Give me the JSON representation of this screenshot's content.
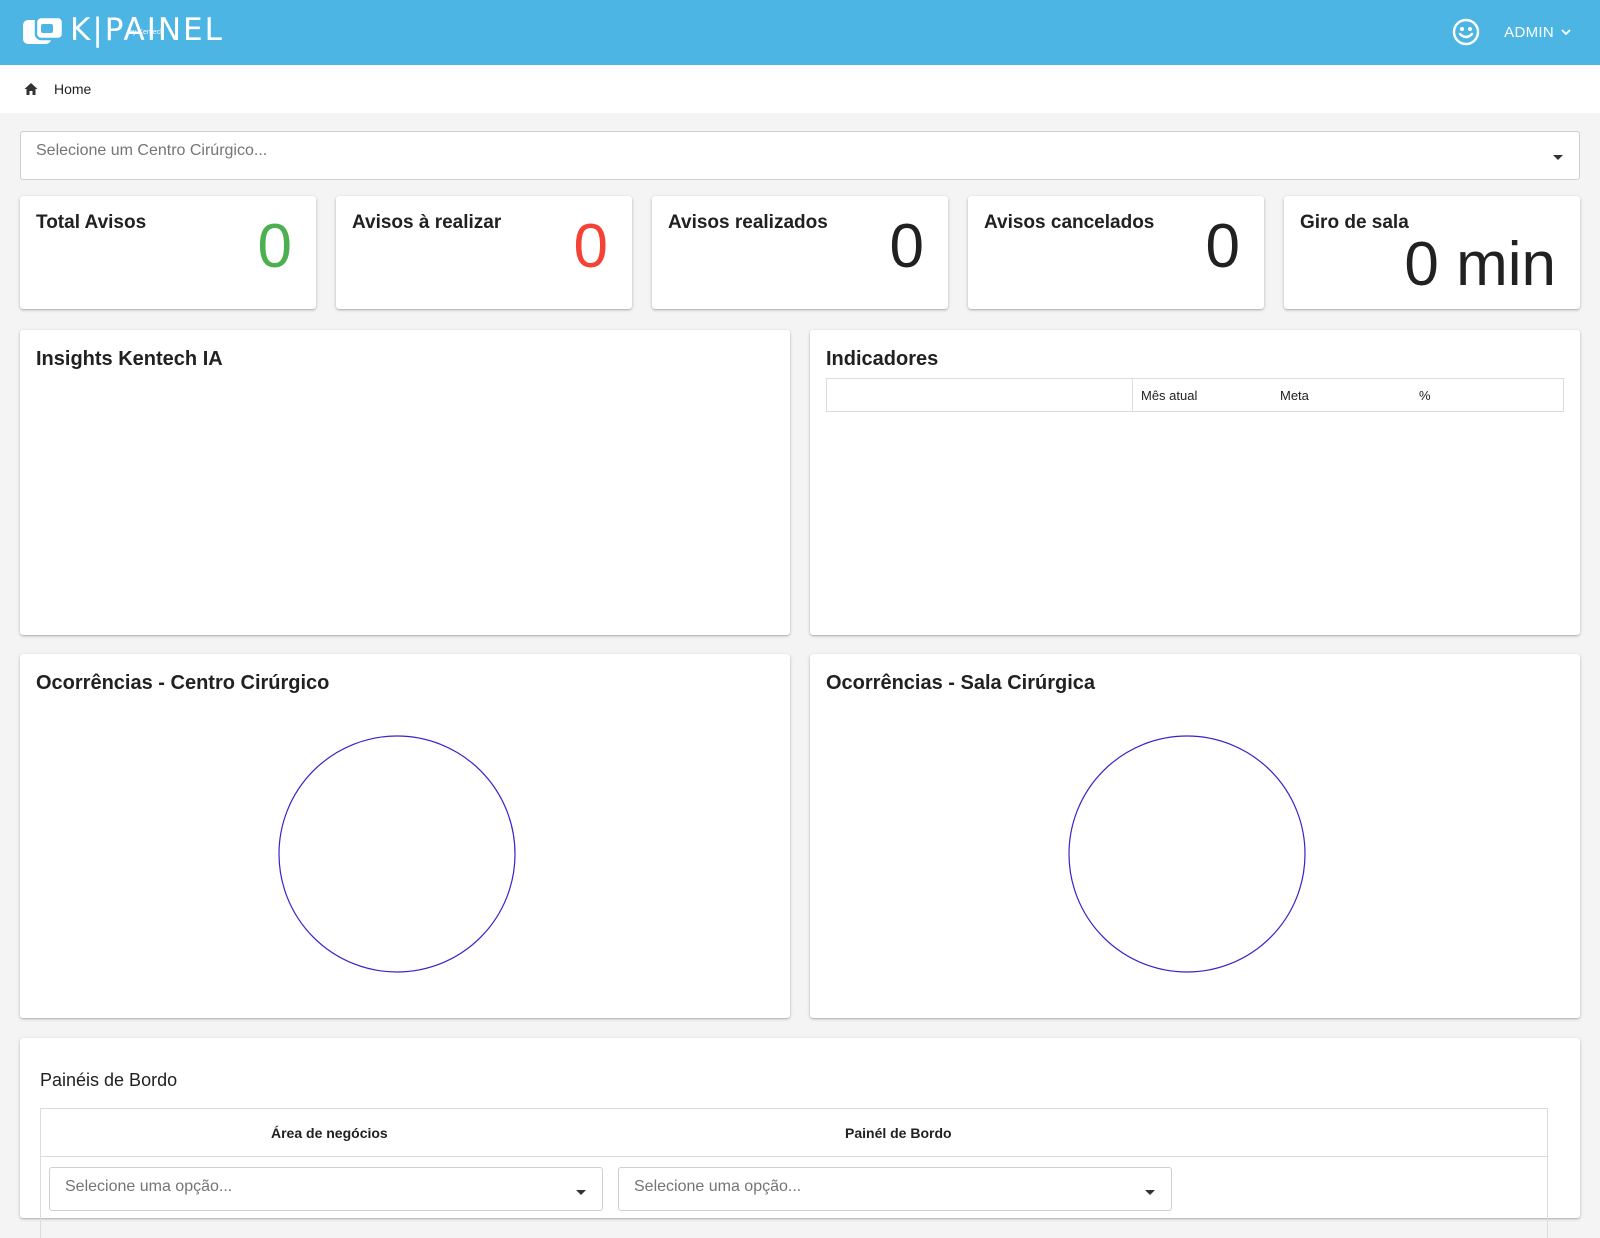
{
  "header": {
    "logo_text": "K|PAINEL",
    "logo_sub": "by Kentech",
    "user_label": "ADMIN",
    "user_icon": "smiley-face-icon",
    "menu_icon": "chevron-down-icon",
    "bar_color": "#4cb5e3"
  },
  "breadcrumb": {
    "icon": "home-icon",
    "label": "Home"
  },
  "centro_select": {
    "placeholder": "Selecione um Centro Cirúrgico..."
  },
  "stats": [
    {
      "title": "Total Avisos",
      "value": "0",
      "color": "#4caf50"
    },
    {
      "title": "Avisos à realizar",
      "value": "0",
      "color": "#f44336"
    },
    {
      "title": "Avisos realizados",
      "value": "0",
      "color": "#212121"
    },
    {
      "title": "Avisos cancelados",
      "value": "0",
      "color": "#212121"
    },
    {
      "title": "Giro de sala",
      "value": "0 min",
      "color": "#212121"
    }
  ],
  "insights": {
    "title": "Insights Kentech IA"
  },
  "indicadores": {
    "title": "Indicadores",
    "columns": [
      "",
      "Mês atual",
      "Meta",
      "%"
    ]
  },
  "ocorrencias_centro": {
    "title": "Ocorrências - Centro Cirúrgico",
    "ring_color": "#3d1fc7"
  },
  "ocorrencias_sala": {
    "title": "Ocorrências - Sala Cirúrgica",
    "ring_color": "#3d1fc7"
  },
  "paineis_bordo": {
    "title": "Painéis de Bordo",
    "columns": [
      "Área de negócios",
      "Painél de Bordo"
    ],
    "area_placeholder": "Selecione uma opção...",
    "painel_placeholder": "Selecione uma opção..."
  }
}
